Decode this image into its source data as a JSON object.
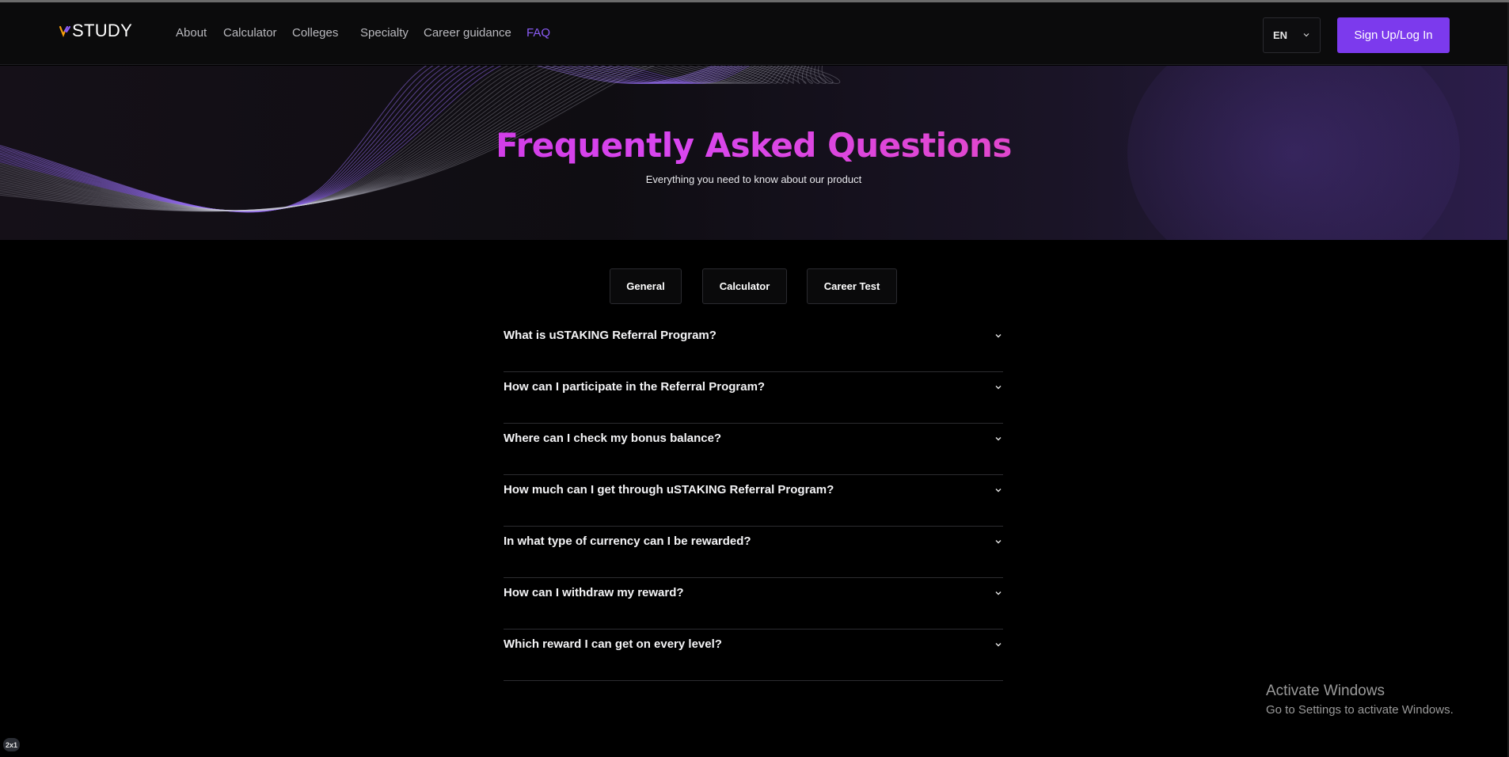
{
  "brand": {
    "logo_text": "STUDY",
    "accent": "#7c3aed",
    "title_gradient": [
      "#c026d3",
      "#ec4899"
    ]
  },
  "nav": {
    "links": [
      {
        "label": "About"
      },
      {
        "label": "Calculator"
      },
      {
        "label": "Colleges"
      },
      {
        "label": "Specialty"
      },
      {
        "label": "Career guidance"
      },
      {
        "label": "FAQ",
        "active": true
      }
    ],
    "language": "EN",
    "signup_label": "Sign Up/Log In"
  },
  "hero": {
    "title": "Frequently Asked Questions",
    "subtitle": "Everything you need to know about our product"
  },
  "tabs": [
    {
      "label": "General"
    },
    {
      "label": "Calculator"
    },
    {
      "label": "Career Test"
    }
  ],
  "faq": [
    {
      "question": "What is uSTAKING Referral Program?"
    },
    {
      "question": "How can I participate in the Referral Program?"
    },
    {
      "question": "Where can I check my bonus balance?"
    },
    {
      "question": "How much can I get through uSTAKING Referral Program?"
    },
    {
      "question": "In what type of currency can I be rewarded?"
    },
    {
      "question": "How can I withdraw my reward?"
    },
    {
      "question": "Which reward I can get on every level?"
    }
  ],
  "watermark": {
    "title": "Activate Windows",
    "subtitle": "Go to Settings to activate Windows."
  },
  "badge": "2x1"
}
